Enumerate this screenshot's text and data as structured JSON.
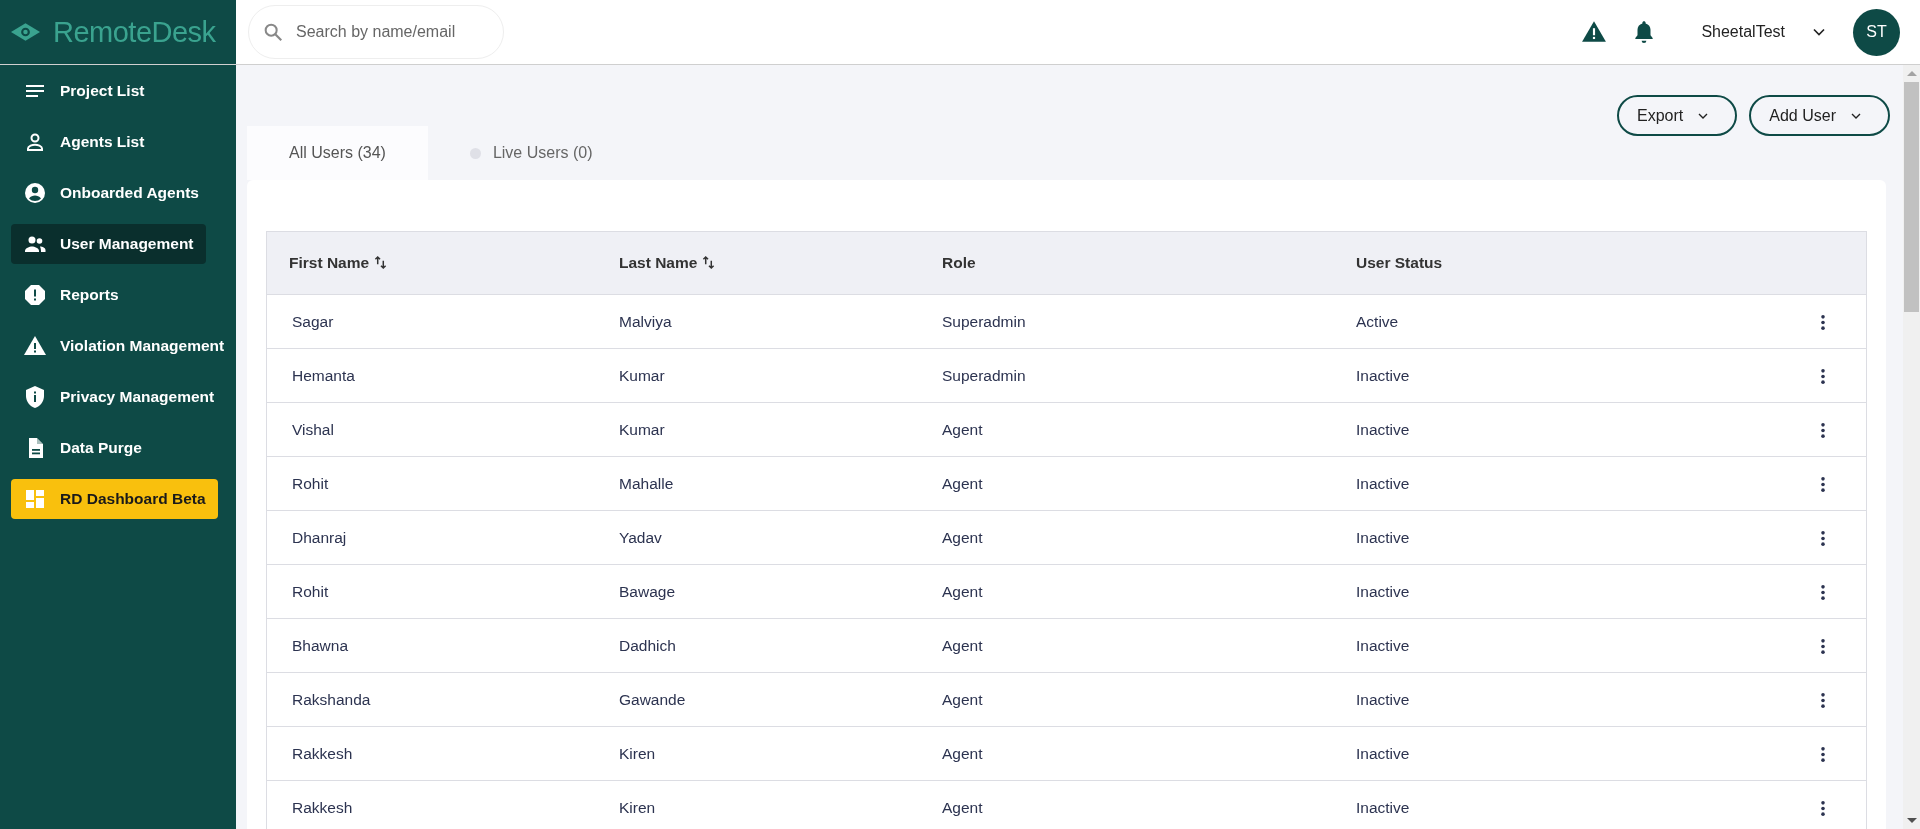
{
  "brand": {
    "name": "RemoteDesk"
  },
  "search": {
    "placeholder": "Search by name/email"
  },
  "user": {
    "name": "SheetalTest",
    "initials": "ST"
  },
  "sidebar": {
    "items": [
      {
        "label": "Project List",
        "kind": "nav",
        "selected": false
      },
      {
        "label": "Agents List",
        "kind": "nav",
        "selected": false
      },
      {
        "label": "Onboarded Agents",
        "kind": "nav",
        "selected": false
      },
      {
        "label": "User Management",
        "kind": "nav",
        "selected": true
      },
      {
        "label": "Reports",
        "kind": "nav",
        "selected": false
      },
      {
        "label": "Violation Management",
        "kind": "nav",
        "selected": false
      },
      {
        "label": "Privacy Management",
        "kind": "nav",
        "selected": false
      },
      {
        "label": "Data Purge",
        "kind": "nav",
        "selected": false
      },
      {
        "label": "RD Dashboard Beta",
        "kind": "promo",
        "selected": false
      }
    ]
  },
  "actions": [
    "Export",
    "Add User"
  ],
  "tabs": [
    {
      "label": "All Users (34)",
      "kind": "plain",
      "selected": true
    },
    {
      "label": "Live Users (0)",
      "kind": "live",
      "selected": false
    }
  ],
  "table": {
    "columns": [
      {
        "label": "First Name",
        "sortable": true
      },
      {
        "label": "Last Name",
        "sortable": true
      },
      {
        "label": "Role",
        "sortable": false
      },
      {
        "label": "User Status",
        "sortable": false
      }
    ],
    "rows": [
      [
        "Sagar",
        "Malviya",
        "Superadmin",
        "Active"
      ],
      [
        "Hemanta",
        "Kumar",
        "Superadmin",
        "Inactive"
      ],
      [
        "Vishal",
        "Kumar",
        "Agent",
        "Inactive"
      ],
      [
        "Rohit",
        "Mahalle",
        "Agent",
        "Inactive"
      ],
      [
        "Dhanraj",
        "Yadav",
        "Agent",
        "Inactive"
      ],
      [
        "Rohit",
        "Bawage",
        "Agent",
        "Inactive"
      ],
      [
        "Bhawna",
        "Dadhich",
        "Agent",
        "Inactive"
      ],
      [
        "Rakshanda",
        "Gawande",
        "Agent",
        "Inactive"
      ],
      [
        "Rakkesh",
        "Kiren",
        "Agent",
        "Inactive"
      ],
      [
        "Rakkesh",
        "Kiren",
        "Agent",
        "Inactive"
      ]
    ]
  }
}
